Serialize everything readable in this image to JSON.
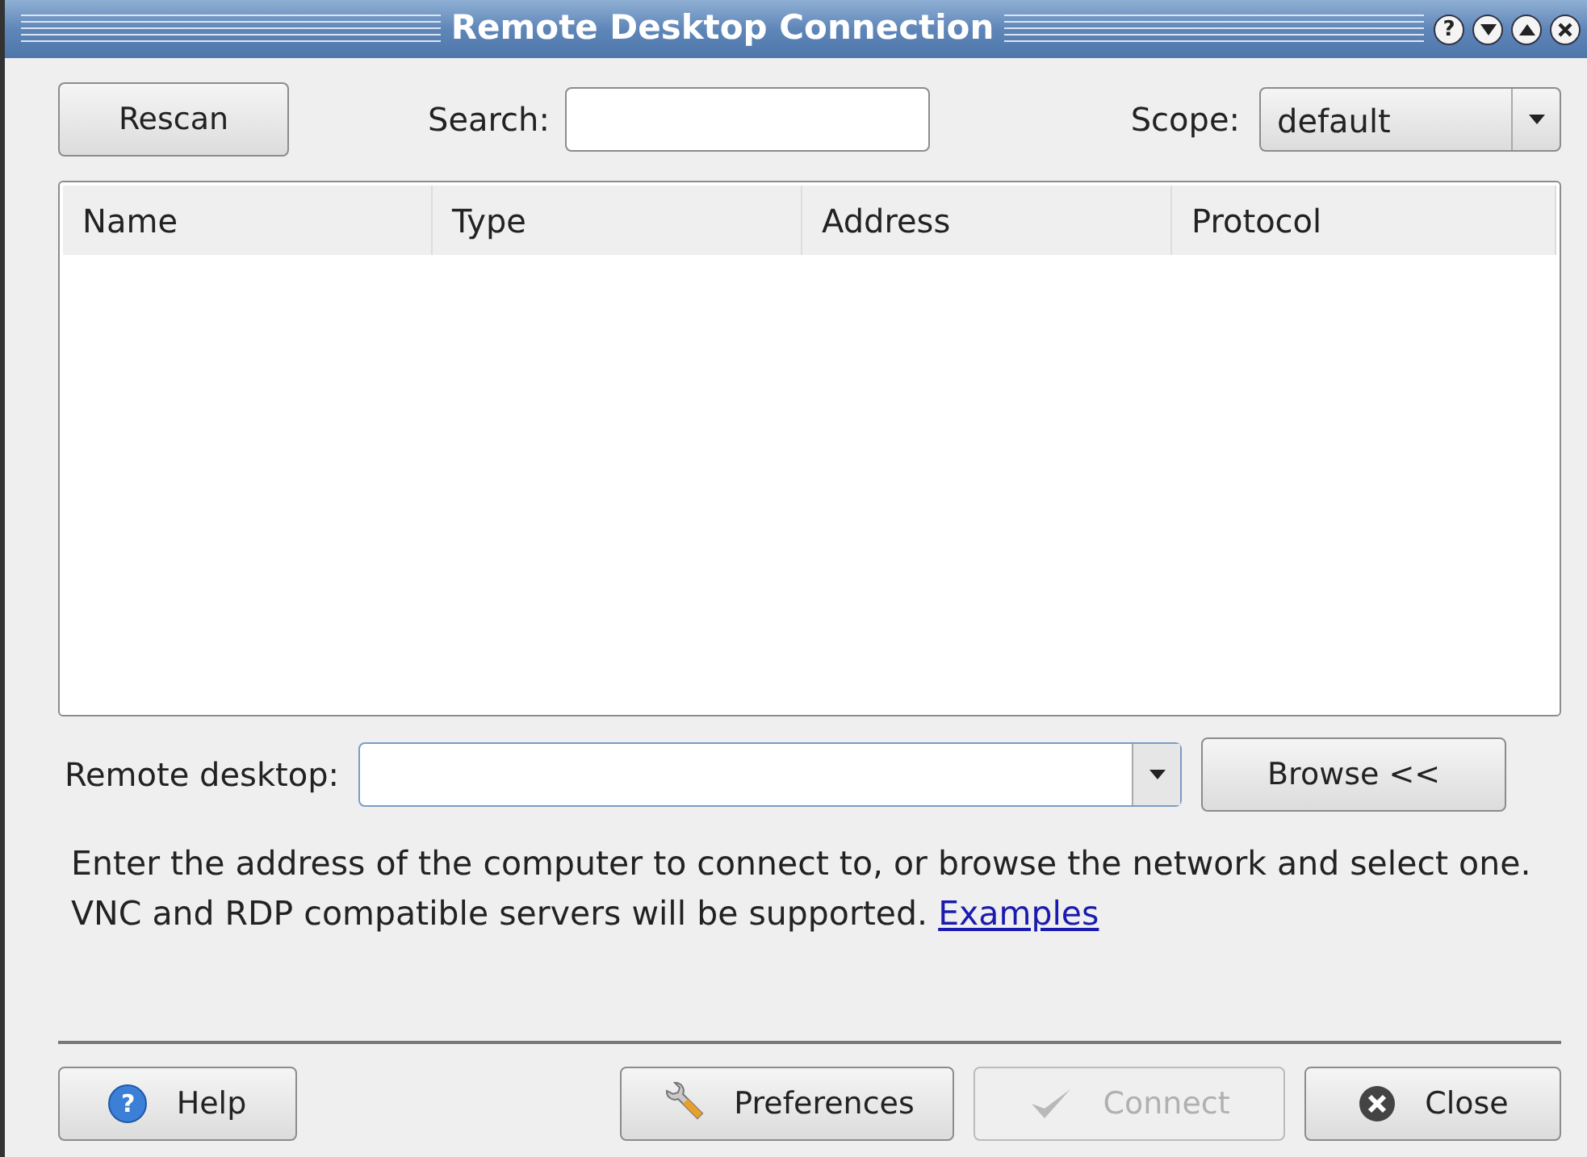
{
  "window": {
    "title": "Remote Desktop Connection",
    "title_buttons": [
      {
        "kind": "help",
        "label": "?"
      },
      {
        "kind": "minimize"
      },
      {
        "kind": "maximize"
      },
      {
        "kind": "close"
      }
    ]
  },
  "rescan_button": {
    "label": "Rescan"
  },
  "search": {
    "label": "Search:"
  },
  "scope": {
    "label": "Scope:",
    "value": "default"
  },
  "table": {
    "columns": [
      "Name",
      "Type",
      "Address",
      "Protocol"
    ]
  },
  "remote_desktop": {
    "label": "Remote desktop:"
  },
  "browse_button": {
    "label": "Browse <<"
  },
  "description": "Enter the address of the computer to connect to, or browse the network and select one. VNC and RDP compatible servers will be supported.",
  "examples_link": "Examples",
  "buttons": [
    {
      "kind": "help",
      "label": "Help",
      "icon_glyph": "?",
      "disabled": false
    },
    {
      "kind": "preferences",
      "label": "Preferences",
      "disabled": false
    },
    {
      "kind": "connect",
      "label": "Connect",
      "disabled": true
    },
    {
      "kind": "close",
      "label": "Close",
      "disabled": false
    }
  ]
}
